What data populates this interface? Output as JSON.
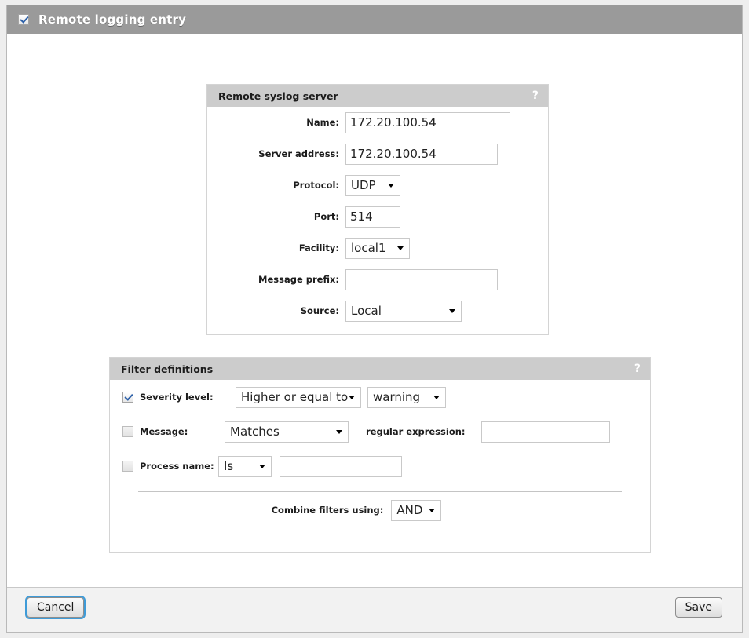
{
  "window": {
    "title": "Remote logging entry",
    "enabled_checkbox": true
  },
  "syslog_panel": {
    "title": "Remote syslog server",
    "help": "?",
    "fields": {
      "name": {
        "label": "Name:",
        "value": "172.20.100.54",
        "placeholder": ""
      },
      "server_address": {
        "label": "Server address:",
        "value": "172.20.100.54",
        "placeholder": ""
      },
      "protocol": {
        "label": "Protocol:",
        "value": "UDP"
      },
      "port": {
        "label": "Port:",
        "value": "514",
        "placeholder": ""
      },
      "facility": {
        "label": "Facility:",
        "value": "local1"
      },
      "message_prefix": {
        "label": "Message prefix:",
        "value": "",
        "placeholder": ""
      },
      "source": {
        "label": "Source:",
        "value": "Local"
      }
    }
  },
  "filter_panel": {
    "title": "Filter definitions",
    "help": "?",
    "severity": {
      "label": "Severity level:",
      "checked": true,
      "operator": "Higher or equal to",
      "value": "warning"
    },
    "message": {
      "label": "Message:",
      "checked": false,
      "operator": "Matches",
      "field_label": "regular expression:",
      "value": "",
      "placeholder": ""
    },
    "process_name": {
      "label": "Process name:",
      "checked": false,
      "operator": "Is",
      "value": "",
      "placeholder": ""
    },
    "combine": {
      "label": "Combine filters using:",
      "value": "AND"
    }
  },
  "footer": {
    "cancel_label": "Cancel",
    "save_label": "Save"
  },
  "colors": {
    "titlebar": "#9a9a9a",
    "panel_header": "#cccccc",
    "accent_focus": "#3e9bd8",
    "check_blue": "#2b5fa8"
  }
}
